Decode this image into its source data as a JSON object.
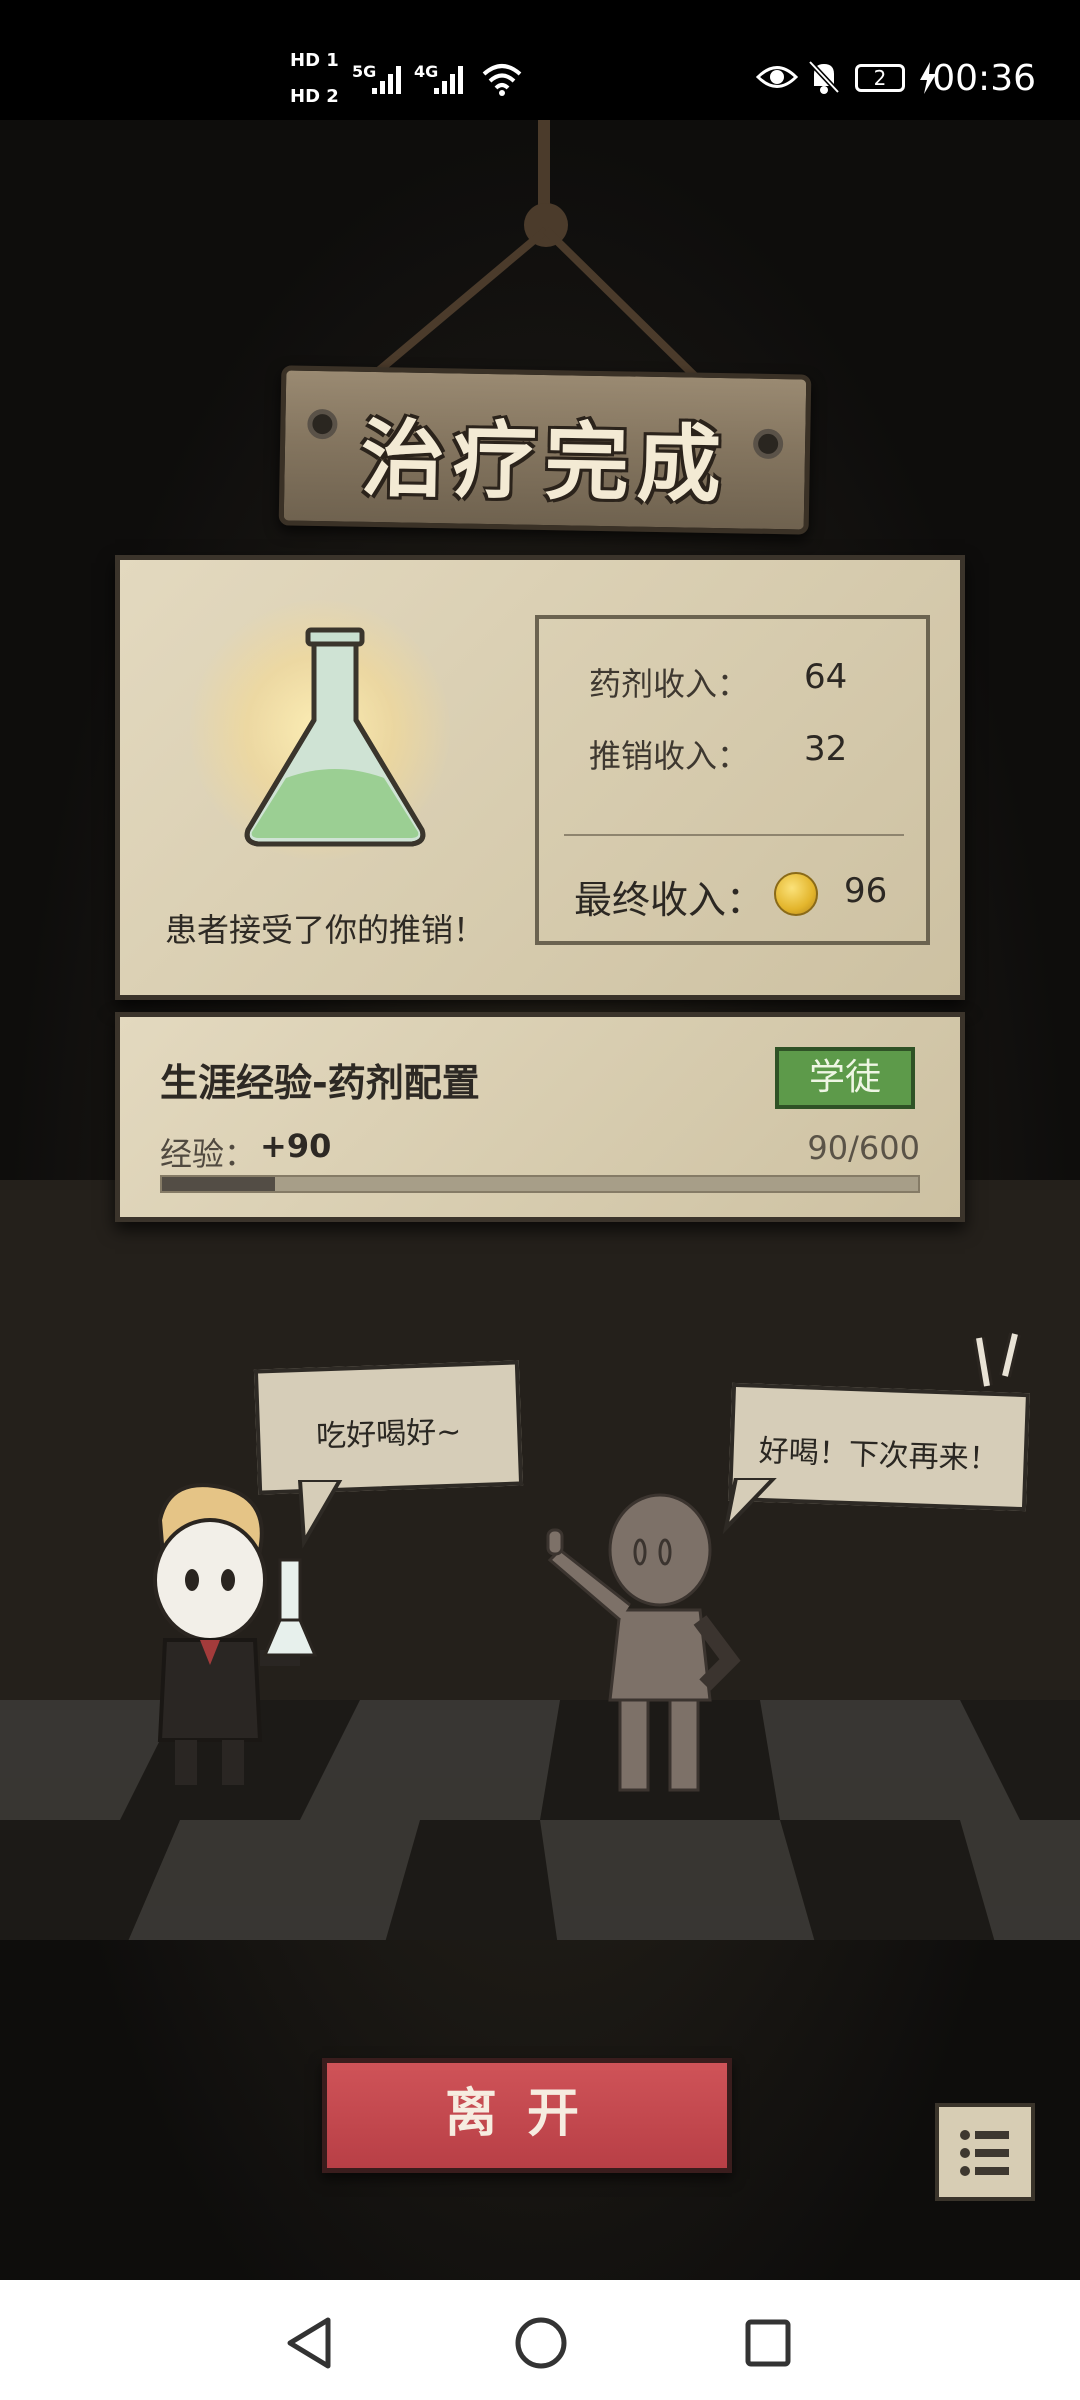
{
  "status_bar": {
    "hd1": "HD 1",
    "hd2": "HD 2",
    "signal1": "5G",
    "signal2": "4G",
    "battery": "2",
    "time": "00:36"
  },
  "sign": {
    "title": "治疗完成"
  },
  "result": {
    "message": "患者接受了你的推销！",
    "potion_income_label": "药剂收入：",
    "potion_income_value": "64",
    "upsell_income_label": "推销收入：",
    "upsell_income_value": "32",
    "final_income_label": "最终收入：",
    "final_income_value": "96"
  },
  "experience": {
    "title": "生涯经验-药剂配置",
    "rank": "学徒",
    "label": "经验：",
    "gain": "+90",
    "progress_text": "90/600",
    "progress_fraction": 0.15
  },
  "dialogue": {
    "doctor": "吃好喝好~",
    "patient": "好喝！下次再来！"
  },
  "buttons": {
    "leave": "离开"
  },
  "colors": {
    "parchment": "#d8cdb0",
    "rank_badge": "#5d9a4a",
    "leave_button": "#c0464c",
    "coin": "#e3b52c"
  },
  "icons": {
    "menu": "list-icon",
    "back": "back-triangle-icon",
    "home": "home-circle-icon",
    "recents": "recents-square-icon"
  }
}
